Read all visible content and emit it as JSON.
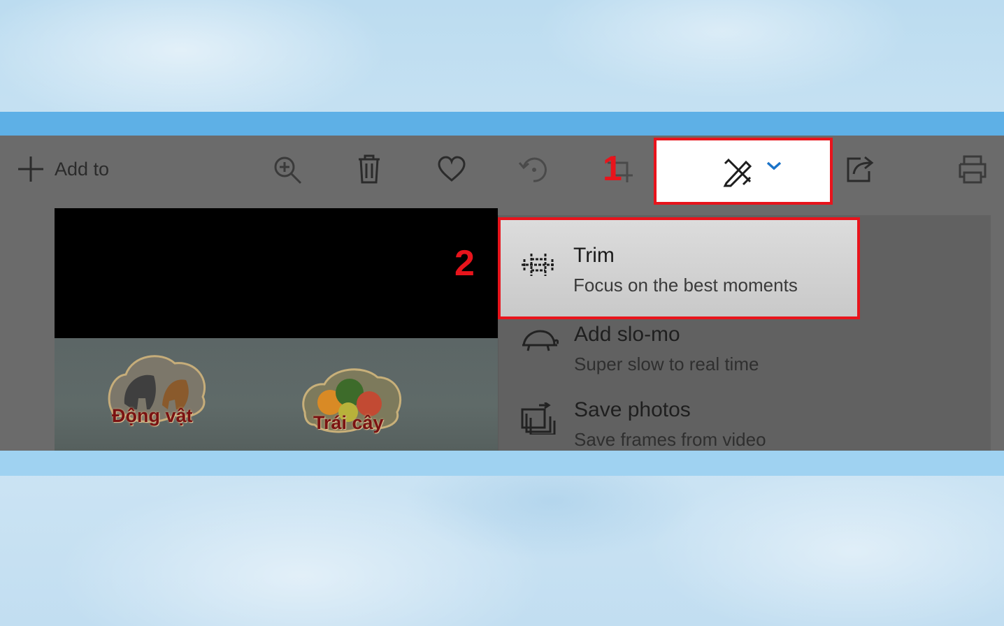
{
  "toolbar": {
    "add_to_label": "Add to",
    "buttons": [
      "zoom-in",
      "delete",
      "favorite",
      "rotate",
      "crop",
      "edit-create",
      "share",
      "print"
    ]
  },
  "annotations": {
    "step1": "1",
    "step2": "2"
  },
  "video": {
    "thumbnails": [
      {
        "label": "Động vật"
      },
      {
        "label": "Trái cây"
      }
    ]
  },
  "menu": {
    "items": [
      {
        "title": "Trim",
        "subtitle": "Focus on the best moments",
        "icon": "trim-icon"
      },
      {
        "title": "Add slo-mo",
        "subtitle": "Super slow to real time",
        "icon": "turtle-icon"
      },
      {
        "title": "Save photos",
        "subtitle": "Save frames from video",
        "icon": "save-photos-icon"
      }
    ]
  },
  "colors": {
    "highlight": "#e8141c",
    "band_top": "#5eb0e6",
    "band_bottom": "#9fd2f1"
  }
}
